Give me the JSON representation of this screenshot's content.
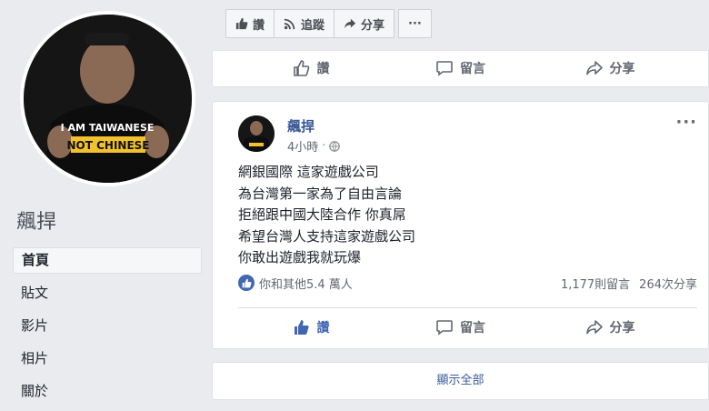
{
  "page": {
    "name": "飆捍"
  },
  "profile_shirt": {
    "line1": "I AM TAIWANESE",
    "line2": "NOT CHINESE"
  },
  "left_nav": {
    "items": [
      {
        "label": "首頁",
        "active": true
      },
      {
        "label": "貼文",
        "active": false
      },
      {
        "label": "影片",
        "active": false
      },
      {
        "label": "相片",
        "active": false
      },
      {
        "label": "關於",
        "active": false
      }
    ]
  },
  "top_actions": {
    "like": "讚",
    "follow": "追蹤",
    "share": "分享",
    "more": "···"
  },
  "prev_post_actions": {
    "like": "讚",
    "comment": "留言",
    "share": "分享"
  },
  "post": {
    "author": "飆捍",
    "time": "4小時",
    "more": "···",
    "lines": [
      "網銀國際 這家遊戲公司",
      "為台灣第一家為了自由言論",
      "拒絕跟中國大陸合作 你真屌",
      "希望台灣人支持這家遊戲公司",
      "你敢出遊戲我就玩爆"
    ],
    "reactions": "你和其他5.4 萬人",
    "comments": "1,177則留言",
    "shares": "264次分享",
    "actions": {
      "like": "讚",
      "comment": "留言",
      "share": "分享"
    }
  },
  "footer": {
    "see_all": "顯示全部"
  },
  "colors": {
    "accent": "#4267b2",
    "link": "#385898",
    "bg": "#e9ebee"
  }
}
